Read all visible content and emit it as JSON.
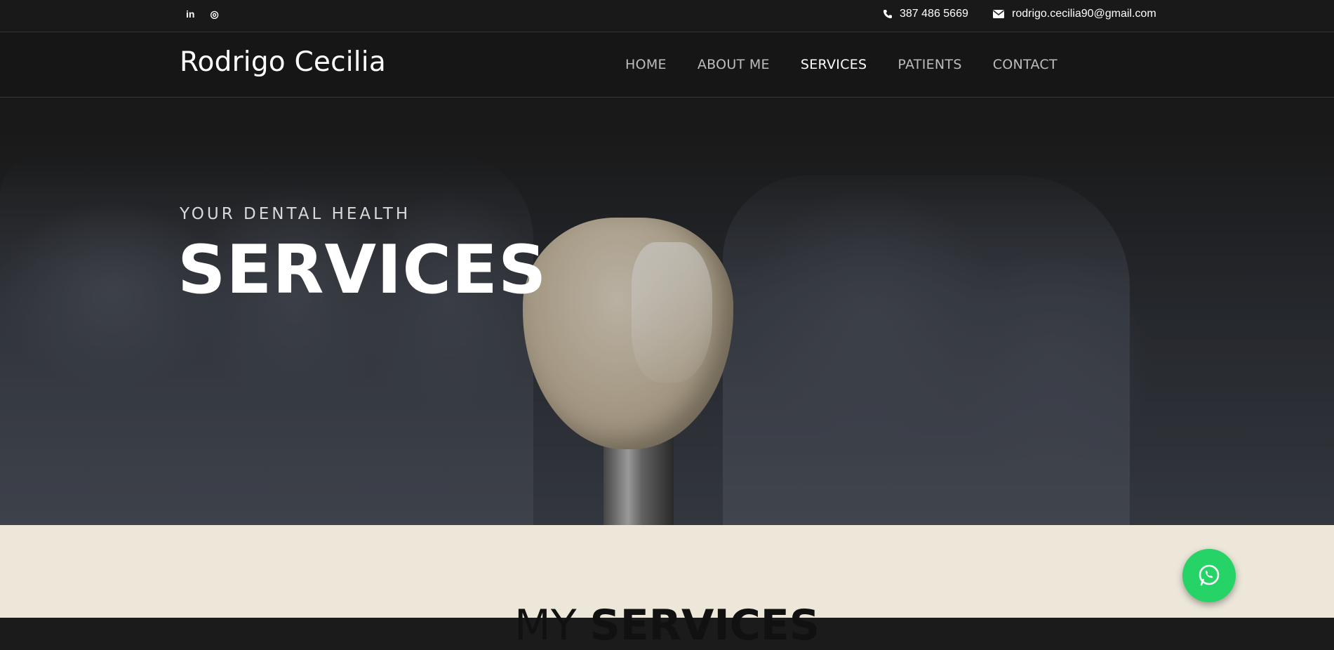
{
  "topbar": {
    "social": [
      {
        "label": "in",
        "icon": "linkedin-icon"
      },
      {
        "label": "◎",
        "icon": "instagram-icon"
      }
    ],
    "phone": "387 486 5669",
    "email": "rodrigo.cecilia90@gmail.com"
  },
  "nav": {
    "brand": "Rodrigo Cecilia",
    "items": [
      {
        "label": "HOME",
        "active": false
      },
      {
        "label": "ABOUT ME",
        "active": false
      },
      {
        "label": "SERVICES",
        "active": true
      },
      {
        "label": "PATIENTS",
        "active": false
      },
      {
        "label": "CONTACT",
        "active": false
      }
    ]
  },
  "hero": {
    "eyebrow": "YOUR DENTAL HEALTH",
    "title": "SERVICES"
  },
  "section": {
    "title_light": "MY ",
    "title_bold": "SERVICES"
  },
  "floating": {
    "icon": "whatsapp-icon",
    "color": "#25d366"
  },
  "colors": {
    "lower_bg": "#ece7d9",
    "topbar_bg": "#191919"
  }
}
